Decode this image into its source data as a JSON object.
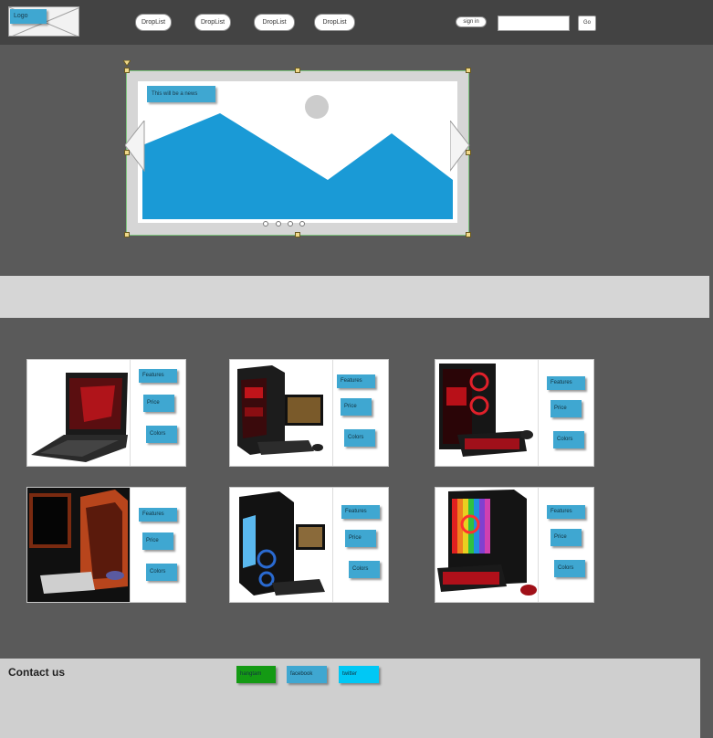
{
  "header": {
    "logo_label": "Logo",
    "nav_items": [
      "DropList",
      "DropList",
      "DropList",
      "DropList"
    ],
    "signin_label": "sign in",
    "search_value": "",
    "go_label": "Go"
  },
  "carousel": {
    "news_label": "This will be a news",
    "slide_count": 4,
    "colors": {
      "mountain": "#1a9ad6",
      "sun": "#cccccc"
    }
  },
  "products": [
    {
      "features_label": "Features",
      "price_label": "Price",
      "colors_label": "Colors",
      "kind": "laptop"
    },
    {
      "features_label": "Features",
      "price_label": "Price",
      "colors_label": "Colors",
      "kind": "desktop-monitor"
    },
    {
      "features_label": "Features",
      "price_label": "Price",
      "colors_label": "Colors",
      "kind": "tower-red"
    },
    {
      "features_label": "Features",
      "price_label": "Price",
      "colors_label": "Colors",
      "kind": "orange-tower"
    },
    {
      "features_label": "Features",
      "price_label": "Price",
      "colors_label": "Colors",
      "kind": "blue-tower"
    },
    {
      "features_label": "Features",
      "price_label": "Price",
      "colors_label": "Colors",
      "kind": "rgb-tower"
    }
  ],
  "footer": {
    "contact_label": "Contact us",
    "social": [
      "hangtam",
      "facebook",
      "twitter"
    ],
    "social_colors": [
      "#149a14",
      "#3fa7d1",
      "#00c8f5"
    ]
  },
  "colors": {
    "accent": "#3fa7d1",
    "topbar": "#434343",
    "page": "#5a5a5a"
  }
}
